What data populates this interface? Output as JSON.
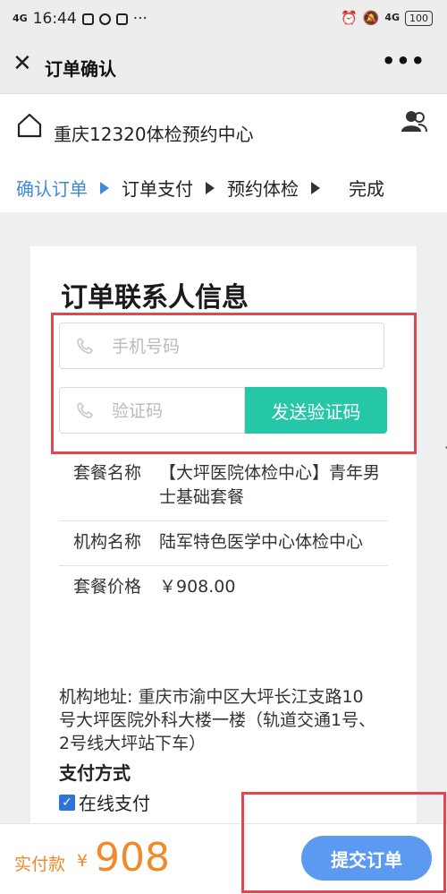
{
  "status_bar": {
    "network": "4G",
    "time": "16:44",
    "more": "···",
    "battery": "100",
    "network_right": "4G"
  },
  "nav": {
    "title": "订单确认",
    "more": "•••"
  },
  "header": {
    "org_name": "重庆12320体检预约中心",
    "steps": [
      "确认订单",
      "订单支付",
      "预约体检",
      "完成"
    ]
  },
  "form": {
    "title": "订单联系人信息",
    "phone_placeholder": "手机号码",
    "code_placeholder": "验证码",
    "send_code_label": "发送验证码"
  },
  "info": {
    "rows": [
      {
        "key": "套餐名称",
        "value": "【大坪医院体检中心】青年男士基础套餐"
      },
      {
        "key": "机构名称",
        "value": "陆军特色医学中心体检中心"
      },
      {
        "key": "套餐价格",
        "value": "￥908.00"
      }
    ],
    "address": "机构地址: 重庆市渝中区大坪长江支路10号大坪医院外科大楼一楼（轨道交通1号、2号线大坪站下车）"
  },
  "payment": {
    "title": "支付方式",
    "option": "在线支付"
  },
  "bottom": {
    "label": "实付款",
    "currency": "¥",
    "amount": "908",
    "submit_label": "提交订单"
  },
  "colors": {
    "accent_blue": "#3f8ad8",
    "send_button": "#25c7a6",
    "submit_button": "#5b9af0",
    "price_orange": "#f08a2a",
    "highlight_red": "#e0474e"
  }
}
